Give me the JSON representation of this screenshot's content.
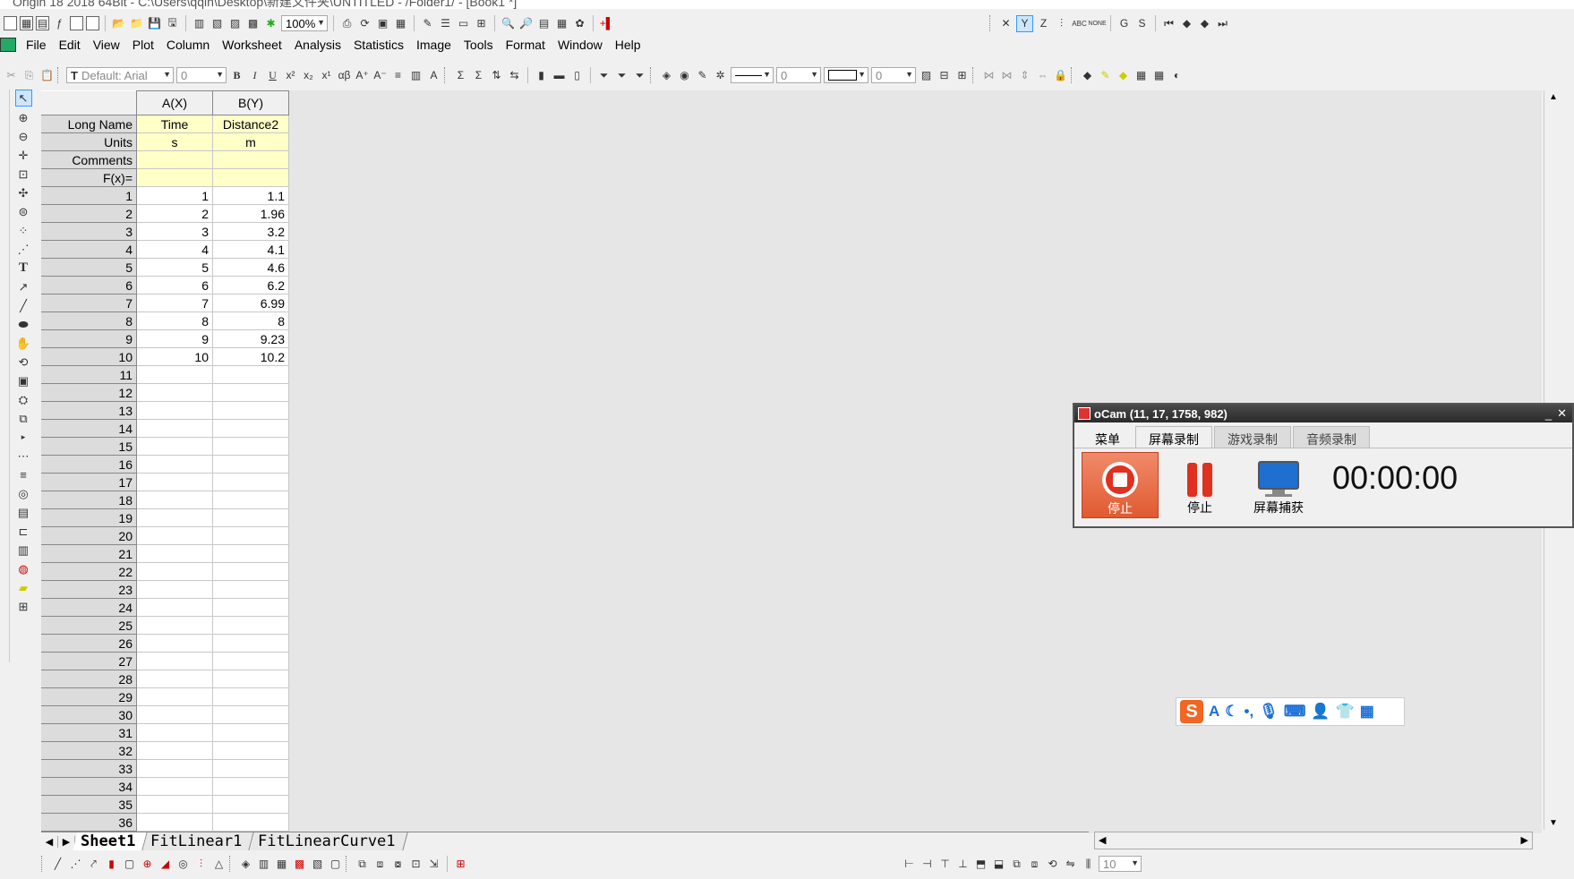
{
  "app": {
    "title_fragment": "Origin 18 2018 64Bit - C:\\Users\\qqin\\Desktop\\新建文件夹\\UNTITLED - /Folder1/ - [Book1 *]"
  },
  "toolbar_top": {
    "zoom": "100%",
    "right_group": [
      "X",
      "Y",
      "Z",
      "G",
      "S"
    ]
  },
  "menu": [
    "File",
    "Edit",
    "View",
    "Plot",
    "Column",
    "Worksheet",
    "Analysis",
    "Statistics",
    "Image",
    "Tools",
    "Format",
    "Window",
    "Help"
  ],
  "format_toolbar": {
    "font": "Default: Arial",
    "size": "0",
    "bold": "B",
    "italic": "I",
    "underline": "U",
    "line_width": "0",
    "border_width": "0"
  },
  "worksheet": {
    "columns": [
      "A(X)",
      "B(Y)"
    ],
    "label_rows": [
      {
        "label": "Long Name",
        "values": [
          "Time",
          "Distance2"
        ]
      },
      {
        "label": "Units",
        "values": [
          "s",
          "m"
        ]
      },
      {
        "label": "Comments",
        "values": [
          "",
          ""
        ]
      },
      {
        "label": "F(x)=",
        "values": [
          "",
          ""
        ]
      }
    ],
    "data_rows": [
      [
        "1",
        "1",
        "1.1"
      ],
      [
        "2",
        "2",
        "1.96"
      ],
      [
        "3",
        "3",
        "3.2"
      ],
      [
        "4",
        "4",
        "4.1"
      ],
      [
        "5",
        "5",
        "4.6"
      ],
      [
        "6",
        "6",
        "6.2"
      ],
      [
        "7",
        "7",
        "6.99"
      ],
      [
        "8",
        "8",
        "8"
      ],
      [
        "9",
        "9",
        "9.23"
      ],
      [
        "10",
        "10",
        "10.2"
      ],
      [
        "11",
        "",
        ""
      ],
      [
        "12",
        "",
        ""
      ],
      [
        "13",
        "",
        ""
      ],
      [
        "14",
        "",
        ""
      ],
      [
        "15",
        "",
        ""
      ],
      [
        "16",
        "",
        ""
      ],
      [
        "17",
        "",
        ""
      ],
      [
        "18",
        "",
        ""
      ],
      [
        "19",
        "",
        ""
      ],
      [
        "20",
        "",
        ""
      ],
      [
        "21",
        "",
        ""
      ],
      [
        "22",
        "",
        ""
      ],
      [
        "23",
        "",
        ""
      ],
      [
        "24",
        "",
        ""
      ],
      [
        "25",
        "",
        ""
      ],
      [
        "26",
        "",
        ""
      ],
      [
        "27",
        "",
        ""
      ],
      [
        "28",
        "",
        ""
      ],
      [
        "29",
        "",
        ""
      ],
      [
        "30",
        "",
        ""
      ],
      [
        "31",
        "",
        ""
      ],
      [
        "32",
        "",
        ""
      ],
      [
        "33",
        "",
        ""
      ],
      [
        "34",
        "",
        ""
      ],
      [
        "35",
        "",
        ""
      ],
      [
        "36",
        "",
        ""
      ]
    ],
    "sheet_tabs": [
      "Sheet1",
      "FitLinear1",
      "FitLinearCurve1"
    ],
    "active_tab": "Sheet1"
  },
  "bottom_toolbar": {
    "size": "10"
  },
  "ocam": {
    "title": "oCam (11, 17, 1758, 982)",
    "tabs": [
      "菜单",
      "屏幕录制",
      "游戏录制",
      "音频录制"
    ],
    "active_tab": "屏幕录制",
    "buttons": [
      "停止",
      "停止",
      "屏幕捕获"
    ],
    "timer": "00:00:00"
  },
  "ime": {
    "logo": "S",
    "mode": "A"
  }
}
